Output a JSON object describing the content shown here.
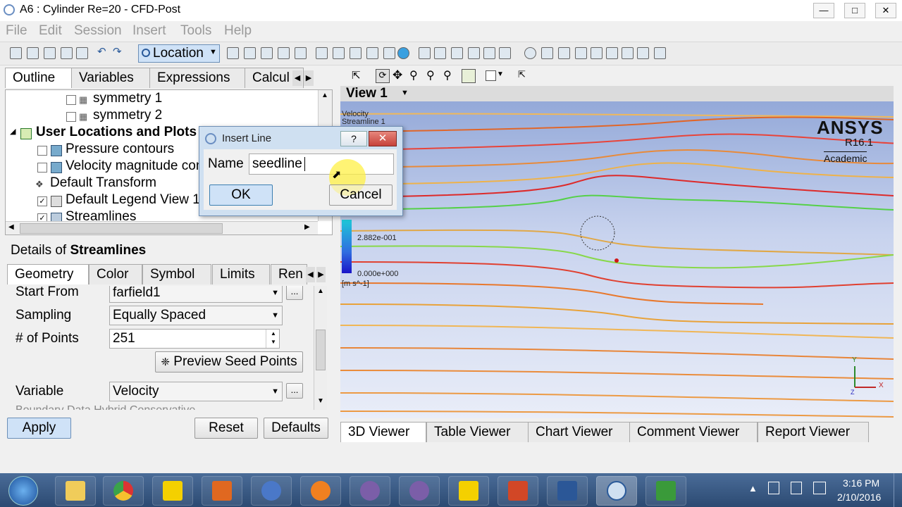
{
  "window": {
    "title": "A6 : Cylinder Re=20 - CFD-Post",
    "controls": [
      "minimize",
      "maximize",
      "close"
    ]
  },
  "menu": [
    "File",
    "Edit",
    "Session",
    "Insert",
    "Tools",
    "Help"
  ],
  "toolbar": {
    "location_label": "Location"
  },
  "outline_tabs": [
    "Outline",
    "Variables",
    "Expressions",
    "Calcul"
  ],
  "tree": {
    "items": [
      {
        "label": "symmetry 1",
        "checked": false
      },
      {
        "label": "symmetry 2",
        "checked": false
      },
      {
        "label": "User Locations and Plots"
      },
      {
        "label": "Pressure contours",
        "checked": false
      },
      {
        "label": "Velocity magnitude contours",
        "checked": false
      },
      {
        "label": "Default Transform"
      },
      {
        "label": "Default Legend View 1",
        "checked": true
      },
      {
        "label": "Streamlines",
        "checked": true
      }
    ]
  },
  "details": {
    "prefix": "Details of",
    "object": "Streamlines",
    "tabs": [
      "Geometry",
      "Color",
      "Symbol",
      "Limits",
      "Ren"
    ],
    "start_from_label": "Start From",
    "start_from_value": "farfield1",
    "sampling_label": "Sampling",
    "sampling_value": "Equally Spaced",
    "points_label": "# of Points",
    "points_value": "251",
    "preview_button": "Preview Seed Points",
    "variable_label": "Variable",
    "variable_value": "Velocity",
    "cut_off_row": "Boundary Data  Hybrid  Conservative",
    "browse_label": "..."
  },
  "actions": {
    "apply": "Apply",
    "reset": "Reset",
    "defaults": "Defaults"
  },
  "viewer": {
    "view_label": "View 1",
    "legend_title_1": "Velocity",
    "legend_title_2": "Streamline 1",
    "legend_mid": "2.882e-001",
    "legend_min": "0.000e+000",
    "legend_unit": "[m s^-1]",
    "brand": "ANSYS",
    "version": "R16.1",
    "edition": "Academic",
    "axis_y": "Y",
    "axis_x": "X",
    "axis_z": "Z"
  },
  "viewer_tabs": [
    "3D Viewer",
    "Table Viewer",
    "Chart Viewer",
    "Comment Viewer",
    "Report Viewer"
  ],
  "dialog": {
    "title": "Insert Line",
    "help": "?",
    "name_label": "Name",
    "name_value": "seedline",
    "ok": "OK",
    "cancel": "Cancel"
  },
  "taskbar": {
    "apps": [
      "Windows Explorer",
      "Google Chrome",
      "ANSYS Workbench",
      "MATLAB",
      "Thunderbird",
      "Firefox",
      "Emacs",
      "Emacs",
      "ANSYS",
      "PowerPoint",
      "Word",
      "CFD-Post",
      "Camtasia"
    ],
    "time": "3:16 PM",
    "date": "2/10/2016"
  },
  "colors": {
    "selection": "#cfe2f7",
    "dialog_bg": "#cfe0f1",
    "close_red": "#c6423b",
    "highlight": "#fff36a"
  }
}
